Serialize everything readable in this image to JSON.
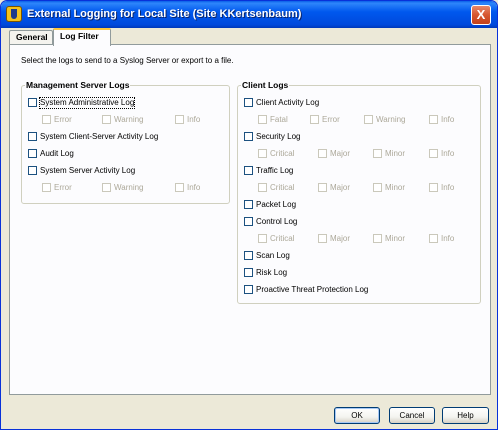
{
  "window": {
    "title": "External Logging for Local Site (Site KKertsenbaum)",
    "close_label": "X"
  },
  "tabs": [
    {
      "label": "General",
      "selected": false
    },
    {
      "label": "Log Filter",
      "selected": true
    }
  ],
  "instructions": "Select the logs to send to a Syslog Server or export to a file.",
  "management": {
    "title": "Management Server Logs",
    "system_admin": {
      "label": "System Administrative Log",
      "error": "Error",
      "warning": "Warning",
      "info": "Info"
    },
    "client_server": "System Client-Server Activity Log",
    "audit": "Audit Log",
    "server_activity": {
      "label": "System Server Activity Log",
      "error": "Error",
      "warning": "Warning",
      "info": "Info"
    }
  },
  "client": {
    "title": "Client Logs",
    "activity": {
      "label": "Client Activity Log",
      "fatal": "Fatal",
      "error": "Error",
      "warning": "Warning",
      "info": "Info"
    },
    "security": {
      "label": "Security Log",
      "critical": "Critical",
      "major": "Major",
      "minor": "Minor",
      "info": "Info"
    },
    "traffic": {
      "label": "Traffic Log",
      "critical": "Critical",
      "major": "Major",
      "minor": "Minor",
      "info": "Info"
    },
    "packet": "Packet Log",
    "control": {
      "label": "Control Log",
      "critical": "Critical",
      "major": "Major",
      "minor": "Minor",
      "info": "Info"
    },
    "scan": "Scan Log",
    "risk": "Risk Log",
    "ptp": "Proactive Threat Protection Log"
  },
  "buttons": {
    "ok": "OK",
    "cancel": "Cancel",
    "help": "Help"
  },
  "colors": {
    "titlebar": "#0058ee",
    "face": "#ece9d8",
    "panel": "#fcfcfe",
    "tab_highlight": "#ffc73c"
  }
}
